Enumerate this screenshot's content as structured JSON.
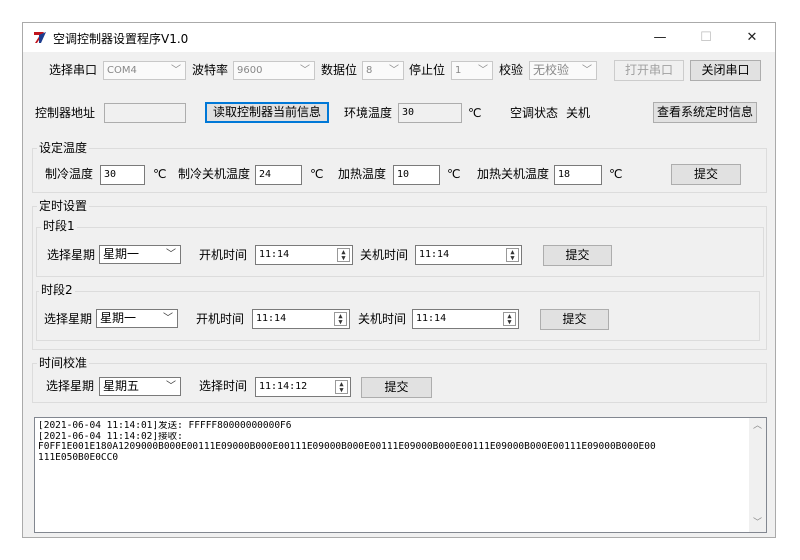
{
  "window": {
    "title": "空调控制器设置程序V1.0",
    "minimize": "—",
    "maximize": "☐",
    "close": "✕"
  },
  "serial": {
    "port_label": "选择串口",
    "port_value": "COM4",
    "baud_label": "波特率",
    "baud_value": "9600",
    "databits_label": "数据位",
    "databits_value": "8",
    "stopbits_label": "停止位",
    "stopbits_value": "1",
    "parity_label": "校验",
    "parity_value": "无校验",
    "open_button": "打开串口",
    "close_button": "关闭串口"
  },
  "controller": {
    "address_label": "控制器地址",
    "address_value": "",
    "read_button": "读取控制器当前信息",
    "env_temp_label": "环境温度",
    "env_temp_value": "30",
    "env_temp_unit": "℃",
    "ac_status_label": "空调状态",
    "ac_status_value": "关机",
    "view_timing_button": "查看系统定时信息"
  },
  "temperature": {
    "group_label": "设定温度",
    "cool_label": "制冷温度",
    "cool_value": "30",
    "cool_unit": "℃",
    "cool_off_label": "制冷关机温度",
    "cool_off_value": "24",
    "cool_off_unit": "℃",
    "heat_label": "加热温度",
    "heat_value": "10",
    "heat_unit": "℃",
    "heat_off_label": "加热关机温度",
    "heat_off_value": "18",
    "heat_off_unit": "℃",
    "submit": "提交"
  },
  "timer": {
    "group_label": "定时设置",
    "period1": {
      "label": "时段1",
      "weekday_label": "选择星期",
      "weekday_value": "星期一",
      "on_label": "开机时间",
      "on_value": "11:14",
      "off_label": "关机时间",
      "off_value": "11:14",
      "submit": "提交"
    },
    "period2": {
      "label": "时段2",
      "weekday_label": "选择星期",
      "weekday_value": "星期一",
      "on_label": "开机时间",
      "on_value": "11:14",
      "off_label": "关机时间",
      "off_value": "11:14",
      "submit": "提交"
    }
  },
  "calibration": {
    "group_label": "时间校准",
    "weekday_label": "选择星期",
    "weekday_value": "星期五",
    "time_label": "选择时间",
    "time_value": "11:14:12",
    "submit": "提交"
  },
  "log": {
    "lines": [
      "[2021-06-04 11:14:01]发送: FFFFF80000000000F6",
      "[2021-06-04 11:14:02]接收:",
      "F0FF1E001E180A1209000B000E00111E09000B000E00111E09000B000E00111E09000B000E00111E09000B000E00111E09000B000E00",
      "111E050B0E0CC0"
    ]
  },
  "colors": {
    "logo_red": "#c0151d",
    "logo_blue": "#1d3d8f",
    "default_button_border": "#0078d7"
  }
}
